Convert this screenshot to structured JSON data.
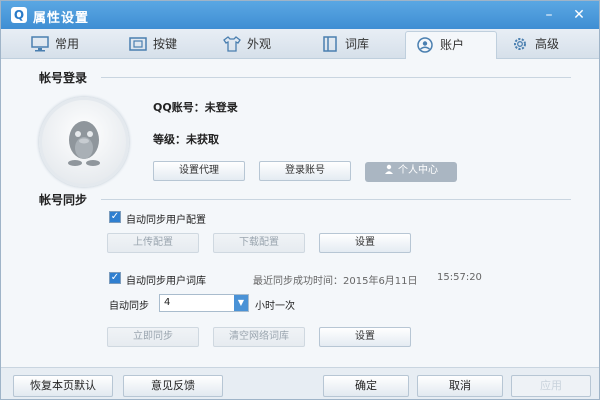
{
  "window": {
    "title": "属性设置",
    "logo_letter": "Q"
  },
  "tabs": [
    {
      "label": "常用",
      "icon": "monitor-icon"
    },
    {
      "label": "按键",
      "icon": "keyboard-icon"
    },
    {
      "label": "外观",
      "icon": "shirt-icon"
    },
    {
      "label": "词库",
      "icon": "book-icon"
    },
    {
      "label": "账户",
      "icon": "account-icon",
      "active": true
    },
    {
      "label": "高级",
      "icon": "gear-icon"
    }
  ],
  "account_login": {
    "section_title": "帐号登录",
    "qq_label": "QQ账号：",
    "qq_value": "未登录",
    "level_label": "等级：",
    "level_value": "未获取",
    "btn_proxy": "设置代理",
    "btn_login": "登录账号",
    "btn_center": "个人中心"
  },
  "account_sync": {
    "section_title": "帐号同步",
    "config_sync_label": "自动同步用户配置",
    "config_sync_checked": true,
    "btn_upload": "上传配置",
    "btn_download": "下载配置",
    "btn_config_settings": "设置",
    "dict_sync_label": "自动同步用户词库",
    "dict_sync_checked": true,
    "last_sync_label": "最近同步成功时间：2015年6月11日",
    "last_sync_time": "15:57:20",
    "auto_sync_label": "自动同步",
    "auto_sync_value": "4",
    "auto_sync_unit": "小时一次",
    "btn_sync_now": "立即同步",
    "btn_clear_dict": "清空网络词库",
    "btn_dict_settings": "设置"
  },
  "footer": {
    "restore_defaults": "恢复本页默认",
    "feedback": "意见反馈",
    "ok": "确定",
    "cancel": "取消",
    "apply": "应用"
  },
  "colors": {
    "titlebar": "#3f8ed3",
    "checkbox": "#2f7fd0",
    "window_bg": "#f4f7fa"
  }
}
